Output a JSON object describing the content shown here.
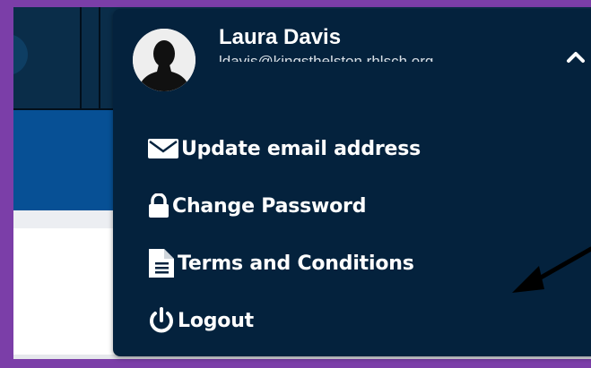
{
  "user": {
    "name": "Laura Davis",
    "email": "ldavis@kingsthelston.rhlsch.org"
  },
  "menu": {
    "items": [
      {
        "label": "Update email address",
        "icon": "envelope-icon"
      },
      {
        "label": "Change Password",
        "icon": "lock-icon"
      },
      {
        "label": "Terms and Conditions",
        "icon": "document-icon"
      },
      {
        "label": "Logout",
        "icon": "power-icon"
      }
    ]
  },
  "colors": {
    "frame": "#7b3ea8",
    "dropdown_bg": "#04223d",
    "header_bg": "#0a2d49",
    "blue_bar": "#075095",
    "text": "#ffffff"
  }
}
